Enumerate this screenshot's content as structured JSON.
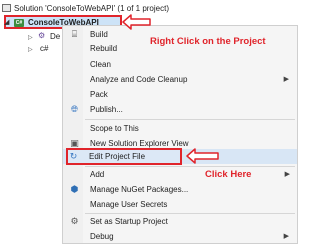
{
  "solution_explorer": {
    "solution_label": "Solution 'ConsoleToWebAPI' (1 of 1 project)",
    "project_name": "ConsoleToWebAPI",
    "child_1_label": "De",
    "child_2_label": "c#"
  },
  "context_menu": {
    "items": [
      {
        "label": "Build",
        "icon": "build-icon"
      },
      {
        "label": "Rebuild",
        "icon": ""
      },
      {
        "label": "Clean",
        "icon": ""
      },
      {
        "label": "Analyze and Code Cleanup",
        "icon": "",
        "submenu": true
      },
      {
        "label": "Pack",
        "icon": ""
      },
      {
        "label": "Publish...",
        "icon": "globe-icon"
      },
      {
        "label": "Scope to This",
        "icon": ""
      },
      {
        "label": "New Solution Explorer View",
        "icon": "new-view-icon"
      },
      {
        "label": "Edit Project File",
        "icon": "edit-file-icon"
      },
      {
        "label": "Add",
        "icon": "",
        "submenu": true
      },
      {
        "label": "Manage NuGet Packages...",
        "icon": "nuget-icon"
      },
      {
        "label": "Manage User Secrets",
        "icon": ""
      },
      {
        "label": "Set as Startup Project",
        "icon": "gear-icon"
      },
      {
        "label": "Debug",
        "icon": "",
        "submenu": true
      }
    ]
  },
  "annotations": {
    "right_click": "Right Click on the Project",
    "click_here": "Click Here"
  },
  "colors": {
    "annotation_red": "#e0242b",
    "highlight_blue": "#d8e6f5"
  }
}
